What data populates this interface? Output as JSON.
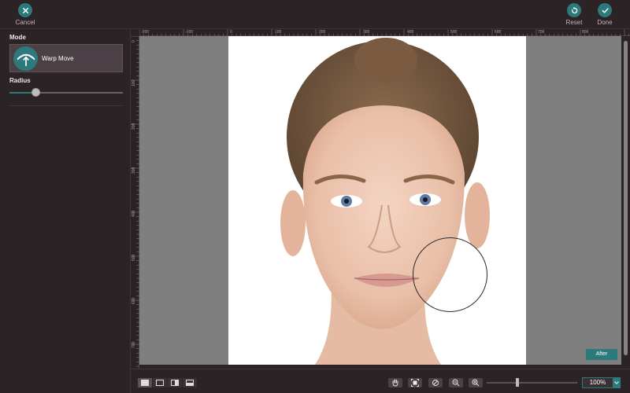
{
  "topbar": {
    "cancel_label": "Cancel",
    "reset_label": "Reset",
    "done_label": "Done"
  },
  "left_panel": {
    "mode_heading": "Mode",
    "mode_option": "Warp Move",
    "radius_heading": "Radius",
    "radius_value": 0.23
  },
  "rulers": {
    "top": [
      "-200",
      "-100",
      "0",
      "100",
      "200",
      "300",
      "400",
      "500",
      "600",
      "700",
      "800"
    ],
    "left": [
      "0",
      "100",
      "200",
      "300",
      "400",
      "500",
      "600",
      "700"
    ]
  },
  "canvas": {
    "after_label": "After"
  },
  "bottombar": {
    "zoom_value": "100%"
  },
  "colors": {
    "accent": "#2d7a7d",
    "background": "#2c2327",
    "canvas_gray": "#7f7f7f"
  }
}
